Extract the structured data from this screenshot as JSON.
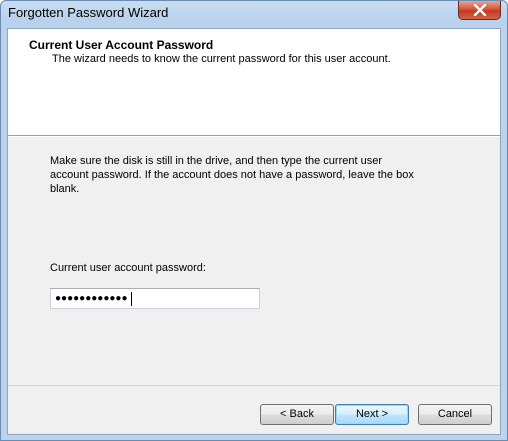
{
  "window": {
    "title": "Forgotten Password Wizard",
    "close_icon": "close-x-icon"
  },
  "header": {
    "title": "Current User Account Password",
    "subtitle": "The wizard needs to know the current password for this user account."
  },
  "body": {
    "instructions": "Make sure the disk is still in the drive, and then type the current user account password. If the account does not have a password, leave the box blank.",
    "password_label": "Current user account password:",
    "password_masked": "●●●●●●●●●●●●"
  },
  "buttons": {
    "back": "< Back",
    "next": "Next >",
    "cancel": "Cancel"
  },
  "colors": {
    "title_bar": "#bcd3ed",
    "close_button": "#c9442a",
    "dialog_background": "#f0f0f0",
    "header_background": "#ffffff",
    "default_button_border": "#3c7fb1"
  }
}
